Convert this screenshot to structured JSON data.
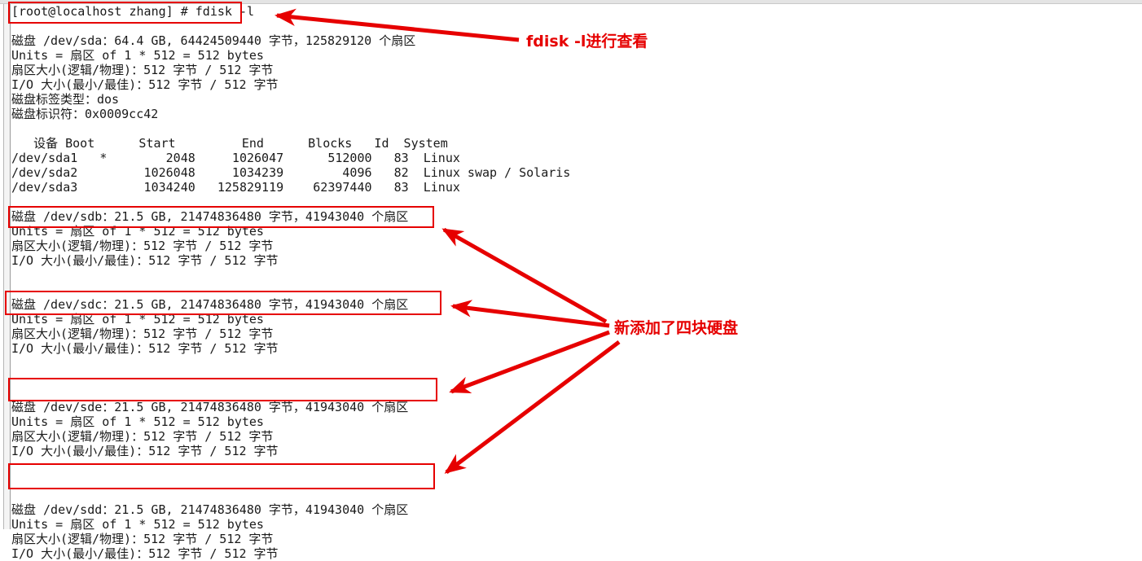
{
  "window": {
    "background": "#ffffff",
    "text_color": "#1a1a1a",
    "annotation_color": "#e60000"
  },
  "terminal": {
    "lines": [
      "[root@localhost zhang] # fdisk -l",
      "",
      "磁盘 /dev/sda：64.4 GB, 64424509440 字节，125829120 个扇区",
      "Units = 扇区 of 1 * 512 = 512 bytes",
      "扇区大小(逻辑/物理)：512 字节 / 512 字节",
      "I/O 大小(最小/最佳)：512 字节 / 512 字节",
      "磁盘标签类型：dos",
      "磁盘标识符：0x0009cc42",
      "",
      "   设备 Boot      Start         End      Blocks   Id  System",
      "/dev/sda1   *        2048     1026047      512000   83  Linux",
      "/dev/sda2         1026048     1034239        4096   82  Linux swap / Solaris",
      "/dev/sda3         1034240   125829119    62397440   83  Linux",
      "",
      "磁盘 /dev/sdb：21.5 GB, 21474836480 字节，41943040 个扇区",
      "Units = 扇区 of 1 * 512 = 512 bytes",
      "扇区大小(逻辑/物理)：512 字节 / 512 字节",
      "I/O 大小(最小/最佳)：512 字节 / 512 字节",
      "",
      "",
      "磁盘 /dev/sdc：21.5 GB, 21474836480 字节，41943040 个扇区",
      "Units = 扇区 of 1 * 512 = 512 bytes",
      "扇区大小(逻辑/物理)：512 字节 / 512 字节",
      "I/O 大小(最小/最佳)：512 字节 / 512 字节",
      "",
      "",
      "",
      "磁盘 /dev/sde：21.5 GB, 21474836480 字节，41943040 个扇区",
      "Units = 扇区 of 1 * 512 = 512 bytes",
      "扇区大小(逻辑/物理)：512 字节 / 512 字节",
      "I/O 大小(最小/最佳)：512 字节 / 512 字节",
      "",
      "",
      "",
      "磁盘 /dev/sdd：21.5 GB, 21474836480 字节，41943040 个扇区",
      "Units = 扇区 of 1 * 512 = 512 bytes",
      "扇区大小(逻辑/物理)：512 字节 / 512 字节",
      "I/O 大小(最小/最佳)：512 字节 / 512 字节"
    ],
    "command": {
      "prompt": "[root@localhost zhang] #",
      "text": "fdisk -l"
    },
    "disk_sda": {
      "name": "/dev/sda",
      "size": "64.4 GB",
      "bytes": "64424509440",
      "sectors": "125829120",
      "units": "扇区 of 1 * 512 = 512 bytes",
      "sector_size": "512 字节 / 512 字节",
      "io_size": "512 字节 / 512 字节",
      "label_type": "dos",
      "identifier": "0x0009cc42"
    },
    "partition_table": {
      "headers": [
        "设备",
        "Boot",
        "Start",
        "End",
        "Blocks",
        "Id",
        "System"
      ],
      "rows": [
        {
          "device": "/dev/sda1",
          "boot": "*",
          "start": "2048",
          "end": "1026047",
          "blocks": "512000",
          "id": "83",
          "system": "Linux"
        },
        {
          "device": "/dev/sda2",
          "boot": "",
          "start": "1026048",
          "end": "1034239",
          "blocks": "4096",
          "id": "82",
          "system": "Linux swap / Solaris"
        },
        {
          "device": "/dev/sda3",
          "boot": "",
          "start": "1034240",
          "end": "125829119",
          "blocks": "62397440",
          "id": "83",
          "system": "Linux"
        }
      ]
    },
    "new_disks": [
      {
        "name": "/dev/sdb",
        "size": "21.5 GB",
        "bytes": "21474836480",
        "sectors": "41943040"
      },
      {
        "name": "/dev/sdc",
        "size": "21.5 GB",
        "bytes": "21474836480",
        "sectors": "41943040"
      },
      {
        "name": "/dev/sde",
        "size": "21.5 GB",
        "bytes": "21474836480",
        "sectors": "41943040"
      },
      {
        "name": "/dev/sdd",
        "size": "21.5 GB",
        "bytes": "21474836480",
        "sectors": "41943040"
      }
    ]
  },
  "annotations": {
    "command_note": "fdisk -l进行查看",
    "disks_note": "新添加了四块硬盘"
  }
}
